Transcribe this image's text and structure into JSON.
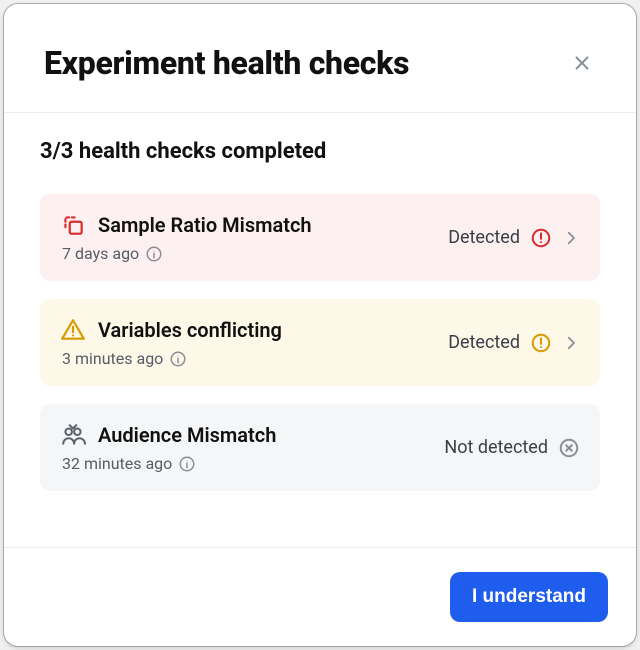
{
  "modal": {
    "title": "Experiment health checks",
    "summary": "3/3 health checks completed",
    "footer_button": "I understand"
  },
  "checks": [
    {
      "title": "Sample Ratio Mismatch",
      "ago": "7 days ago",
      "status": "Detected",
      "severity": "error",
      "icon": "srm-icon",
      "color_bg": "#fdf0f0",
      "color_status": "#d82c2c"
    },
    {
      "title": "Variables conflicting",
      "ago": "3 minutes ago",
      "status": "Detected",
      "severity": "warning",
      "icon": "warning-triangle-icon",
      "color_bg": "#fdf8e8",
      "color_status": "#d99a00"
    },
    {
      "title": "Audience Mismatch",
      "ago": "32 minutes ago",
      "status": "Not detected",
      "severity": "none",
      "icon": "audience-icon",
      "color_bg": "#f5f6f7",
      "color_status": "#8a8f98"
    }
  ]
}
